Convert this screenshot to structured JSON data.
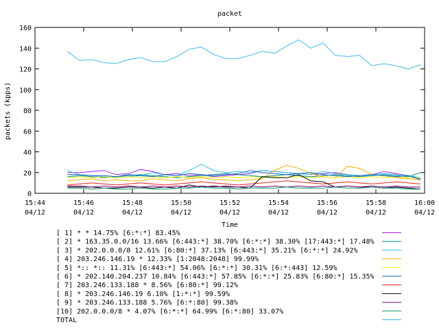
{
  "chart_data": {
    "type": "line",
    "title": "packet",
    "xlabel": "Time",
    "ylabel": "packets (kpps)",
    "ylim": [
      0,
      160
    ],
    "yticks": [
      0,
      20,
      40,
      60,
      80,
      100,
      120,
      140,
      160
    ],
    "xlim_minutes": [
      0,
      16
    ],
    "xticks": [
      {
        "time": "15:44",
        "date": "04/12"
      },
      {
        "time": "15:46",
        "date": "04/12"
      },
      {
        "time": "15:48",
        "date": "04/12"
      },
      {
        "time": "15:50",
        "date": "04/12"
      },
      {
        "time": "15:52",
        "date": "04/12"
      },
      {
        "time": "15:54",
        "date": "04/12"
      },
      {
        "time": "15:56",
        "date": "04/12"
      },
      {
        "time": "15:58",
        "date": "04/12"
      },
      {
        "time": "16:00",
        "date": "04/12"
      }
    ],
    "x": [
      "15:45:20",
      "15:45:50",
      "15:46:20",
      "15:46:50",
      "15:47:20",
      "15:47:50",
      "15:48:20",
      "15:48:50",
      "15:49:20",
      "15:49:50",
      "15:50:20",
      "15:50:50",
      "15:51:20",
      "15:51:50",
      "15:52:20",
      "15:52:50",
      "15:53:20",
      "15:53:50",
      "15:54:20",
      "15:54:50",
      "15:55:20",
      "15:55:50",
      "15:56:20",
      "15:56:50",
      "15:57:20",
      "15:57:50",
      "15:58:20",
      "15:58:50",
      "15:59:20",
      "15:59:50"
    ],
    "legend_placement": "bottom",
    "grid": false,
    "series": [
      {
        "name": "[ 1] * * 14.75%  [6:*:*] 83.45%",
        "color": "#a020f0",
        "values": [
          20,
          20,
          21,
          22,
          18,
          19,
          23,
          21,
          18,
          19,
          17,
          18,
          16,
          17,
          18,
          19,
          22,
          21,
          20,
          19,
          18,
          19,
          20,
          18,
          17,
          18,
          21,
          19,
          17,
          14
        ]
      },
      {
        "name": "[ 2] * 163.35.0.0/16 13.66%  [6:443:*] 38.70% [6:*:*] 38.30% [17:443:*] 17.48%",
        "color": "#008b8b",
        "values": [
          16,
          17,
          16,
          15,
          16,
          17,
          18,
          17,
          16,
          15,
          16,
          17,
          18,
          19,
          18,
          17,
          16,
          17,
          18,
          17,
          16,
          17,
          18,
          17,
          16,
          17,
          18,
          17,
          16,
          20
        ]
      },
      {
        "name": "[ 3] * 202.0.0.0/8 12.61%  [6:80:*] 37.13% [6:443:*] 35.21% [6:*:*] 24.92%",
        "color": "#20c0e0",
        "values": [
          22,
          18,
          17,
          16,
          15,
          16,
          17,
          20,
          18,
          17,
          22,
          28,
          22,
          20,
          21,
          20,
          22,
          21,
          20,
          19,
          18,
          21,
          19,
          18,
          17,
          18,
          19,
          18,
          17,
          15
        ]
      },
      {
        "name": "[ 4] 203.246.146.19 * 12.33%  [1:2048:2048] 99.99%",
        "color": "#f0b000",
        "values": [
          12,
          13,
          14,
          12,
          13,
          12,
          12,
          14,
          13,
          12,
          14,
          15,
          13,
          13,
          12,
          13,
          14,
          22,
          27,
          24,
          19,
          16,
          15,
          26,
          24,
          18,
          17,
          15,
          14,
          13
        ]
      },
      {
        "name": "[ 5] *:: *:: 11.31%  [6:443:*] 54.06% [6:*:*] 30.31% [6:*:443] 12.59%",
        "color": "#f0f000",
        "values": [
          15,
          16,
          15,
          16,
          15,
          16,
          15,
          16,
          15,
          16,
          15,
          16,
          15,
          16,
          15,
          16,
          15,
          16,
          15,
          16,
          15,
          16,
          15,
          16,
          15,
          16,
          15,
          16,
          15,
          15
        ]
      },
      {
        "name": "[ 6] * 202.140.204.237 10.84%  [6:443:*] 57.85% [6:*:*] 25.83% [6:80:*] 15.35%",
        "color": "#1060c0",
        "values": [
          18,
          18,
          17,
          17,
          16,
          18,
          17,
          16,
          18,
          17,
          19,
          18,
          17,
          18,
          19,
          22,
          20,
          19,
          18,
          19,
          20,
          18,
          17,
          16,
          17,
          18,
          17,
          16,
          17,
          13
        ]
      },
      {
        "name": "[ 7] 203.246.133.188 * 8.56%  [6:80:*] 99.12%",
        "color": "#e02020",
        "values": [
          8,
          9,
          10,
          9,
          8,
          9,
          10,
          9,
          8,
          9,
          10,
          11,
          10,
          9,
          8,
          9,
          10,
          11,
          12,
          11,
          10,
          9,
          10,
          11,
          10,
          9,
          10,
          11,
          10,
          9
        ]
      },
      {
        "name": "[ 8] * 203.246.146.19 6.10%  [1:*:*] 99.59%",
        "color": "#000000",
        "values": [
          6,
          6,
          6,
          5,
          5,
          6,
          6,
          5,
          6,
          5,
          8,
          6,
          7,
          6,
          6,
          5,
          16,
          15,
          15,
          18,
          12,
          11,
          6,
          7,
          6,
          6,
          5,
          6,
          5,
          4
        ]
      },
      {
        "name": "[ 9] * 203.246.133.188 5.76%  [6:*:80] 99.38%",
        "color": "#800080",
        "values": [
          7,
          7,
          6,
          7,
          6,
          7,
          6,
          7,
          6,
          7,
          6,
          7,
          6,
          7,
          6,
          7,
          6,
          7,
          6,
          7,
          6,
          7,
          6,
          7,
          6,
          7,
          6,
          7,
          6,
          6
        ]
      },
      {
        "name": "[10] 202.0.0.0/8 * 4.07%  [6:*:*] 64.99% [6:*:80] 33.07%",
        "color": "#009060",
        "values": [
          5,
          5,
          4,
          5,
          4,
          4,
          5,
          4,
          4,
          5,
          5,
          6,
          5,
          5,
          4,
          5,
          5,
          5,
          6,
          5,
          5,
          5,
          6,
          5,
          5,
          6,
          5,
          5,
          4,
          4
        ]
      },
      {
        "name": "TOTAL",
        "color": "#40b8e8",
        "values": [
          137,
          128,
          129,
          126,
          125,
          129,
          131,
          127,
          127,
          132,
          139,
          141,
          134,
          130,
          130,
          133,
          137,
          135,
          142,
          148,
          140,
          145,
          133,
          132,
          133,
          123,
          125,
          123,
          120,
          124
        ]
      }
    ]
  }
}
